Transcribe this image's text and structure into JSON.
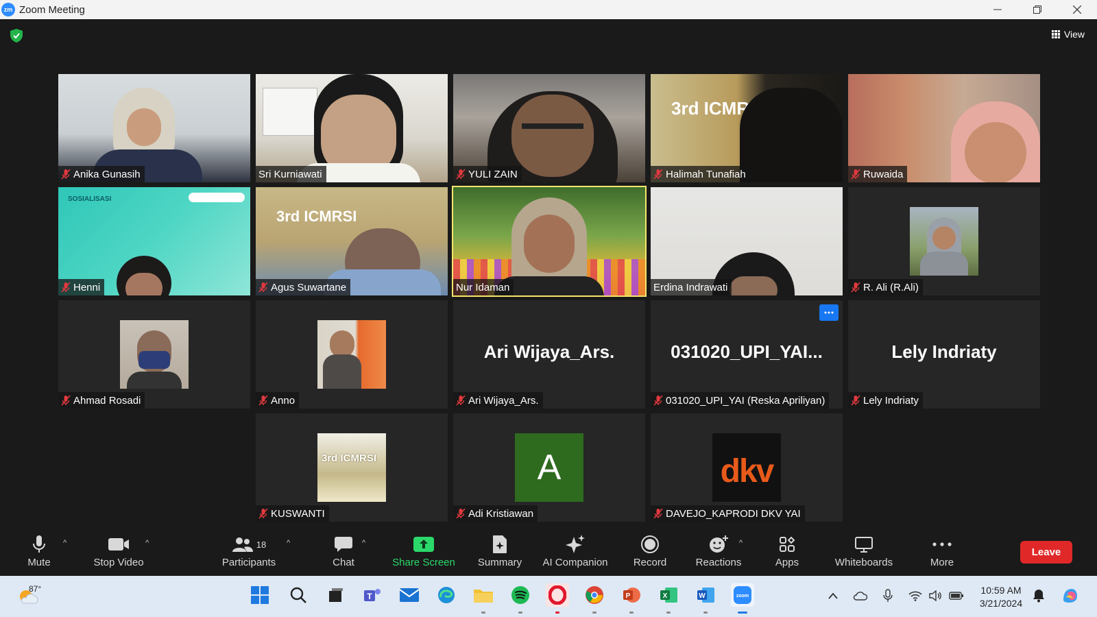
{
  "window": {
    "title": "Zoom Meeting",
    "logo_text": "zm"
  },
  "header": {
    "view_label": "View"
  },
  "tiles": [
    {
      "name": "Anika Gunasih",
      "muted": true
    },
    {
      "name": "Sri Kurniawati",
      "muted": false
    },
    {
      "name": "YULI ZAIN",
      "muted": true
    },
    {
      "name": "Halimah Tunafiah",
      "muted": true
    },
    {
      "name": "Ruwaida",
      "muted": true
    },
    {
      "name": "Henni",
      "muted": true
    },
    {
      "name": "Agus Suwartane",
      "muted": true
    },
    {
      "name": "Nur Idaman",
      "muted": false,
      "active": true
    },
    {
      "name": "Erdina Indrawati",
      "muted": false
    },
    {
      "name": "R. Ali (R.Ali)",
      "muted": true
    },
    {
      "name": "Ahmad Rosadi",
      "muted": true
    },
    {
      "name": "Anno",
      "muted": true
    },
    {
      "name": "Ari Wijaya_Ars.",
      "muted": true,
      "big_name": "Ari Wijaya_Ars."
    },
    {
      "name": "031020_UPI_YAI (Reska Apriliyan)",
      "muted": true,
      "big_name": "031020_UPI_YAI..."
    },
    {
      "name": "Lely Indriaty",
      "muted": true,
      "big_name": "Lely Indriaty"
    },
    {
      "name": "KUSWANTI",
      "muted": true
    },
    {
      "name": "Adi Kristiawan",
      "muted": true,
      "avatar_letter": "A"
    },
    {
      "name": "DAVEJO_KAPRODI DKV YAI",
      "muted": true
    }
  ],
  "thumb_text": {
    "sosialisasi": "SOSIALISASI",
    "icmrsi": "3rd ICMRSI",
    "dkv": "dkv"
  },
  "toolbar": {
    "mute": "Mute",
    "stop_video": "Stop Video",
    "participants": "Participants",
    "participants_count": "18",
    "chat": "Chat",
    "share_screen": "Share Screen",
    "summary": "Summary",
    "ai_companion": "AI Companion",
    "record": "Record",
    "reactions": "Reactions",
    "apps": "Apps",
    "whiteboards": "Whiteboards",
    "more": "More",
    "leave": "Leave"
  },
  "taskbar": {
    "temperature": "87°",
    "time": "10:59 AM",
    "date": "3/21/2024"
  },
  "colors": {
    "accent_green": "#2bd96a",
    "leave_red": "#e02828",
    "active_outline": "#f5e66b",
    "zoom_blue": "#2d8cff"
  }
}
